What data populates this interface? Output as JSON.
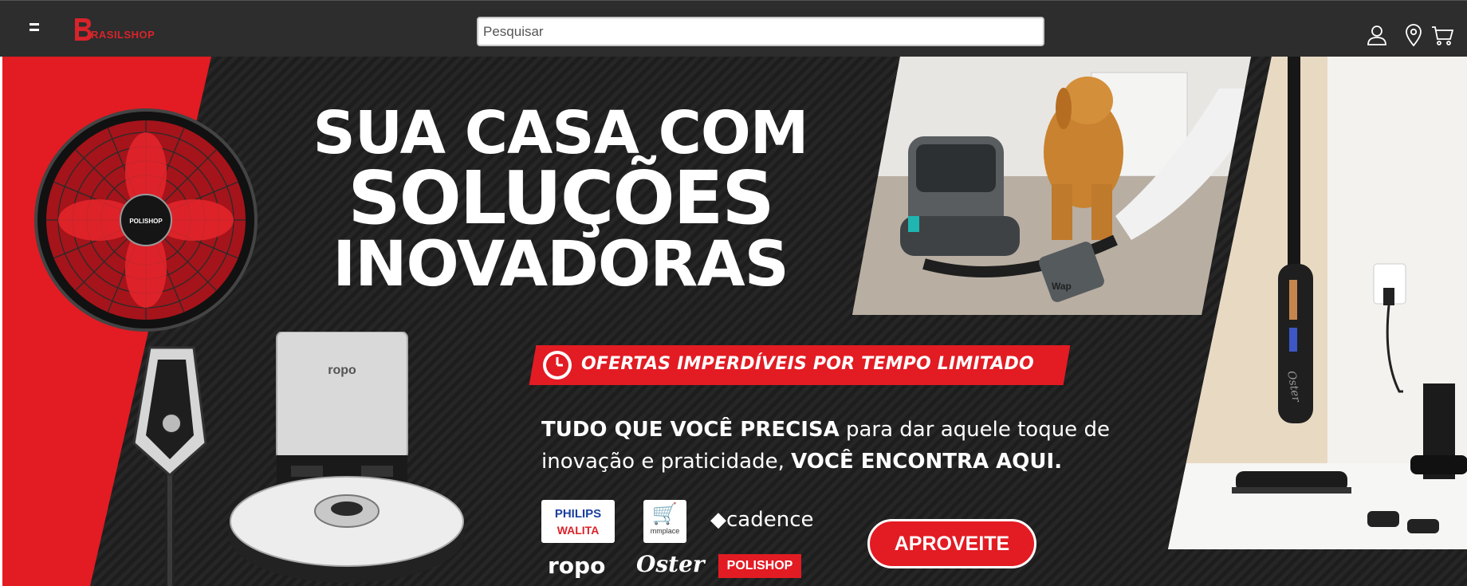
{
  "header": {
    "logo_text": "RASILSHOP",
    "logo_letter": "B",
    "search_placeholder": "Pesquisar",
    "icons": [
      "menu-icon",
      "user-icon",
      "location-pin-icon",
      "cart-icon"
    ]
  },
  "banner": {
    "headline_line1": "SUA CASA COM",
    "headline_line2": "SOLUÇÕES",
    "headline_line3": "INOVADORAS",
    "offer": "OFERTAS IMPERDÍVEIS POR TEMPO LIMITADO",
    "desc_bold1": "TUDO QUE VOCÊ PRECISA",
    "desc_normal1": " para dar aquele toque de",
    "desc_normal2": "inovação e praticidade, ",
    "desc_bold2": "VOCÊ ENCONTRA AQUI.",
    "brands": {
      "philips_top": "PHILIPS",
      "philips_bottom": "WALITA",
      "mmplace": "mmplace",
      "cadence": "cadence",
      "ropo": "ropo",
      "oster": "Oster",
      "polishop": "POLISHOP"
    },
    "product_labels": {
      "robot_brand": "ropo",
      "fan_brand": "POLISHOP",
      "vacuum_brand": "Oster",
      "pet_vacuum_brand": "Wap"
    },
    "cta_label": "APROVEITE"
  },
  "colors": {
    "header_bg": "#2d2d2d",
    "accent_red": "#e31b23",
    "banner_bg": "#1d1d1d"
  }
}
